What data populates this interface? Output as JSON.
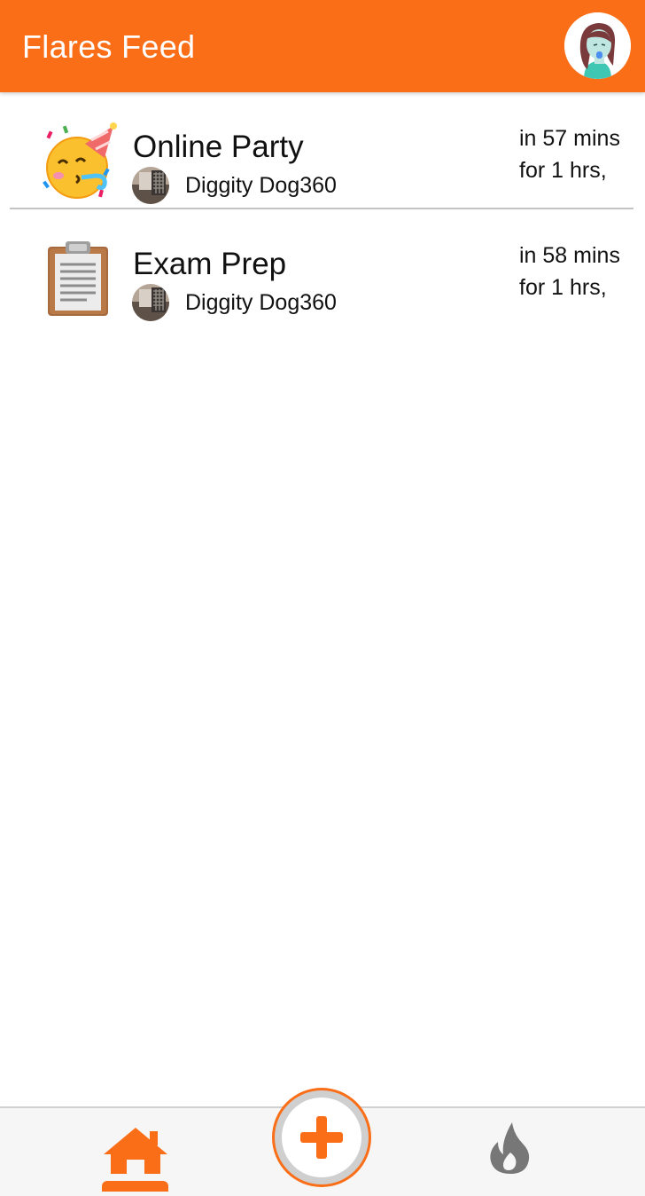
{
  "app_bar": {
    "title": "Flares Feed",
    "profile_icon": "user-avatar-icon"
  },
  "theme": {
    "accent": "#fa6e18",
    "background": "#ffffff",
    "nav_background": "#f6f6f6",
    "inactive_icon": "#777777"
  },
  "feed": {
    "items": [
      {
        "icon": "party-face-emoji-icon",
        "title": "Online Party",
        "host_name": "Diggity Dog360",
        "host_avatar": "host-avatar-icon",
        "starts": "in 57 mins",
        "duration": "for 1 hrs,"
      },
      {
        "icon": "clipboard-emoji-icon",
        "title": "Exam Prep",
        "host_name": "Diggity Dog360",
        "host_avatar": "host-avatar-icon",
        "starts": "in 58 mins",
        "duration": "for 1 hrs,"
      }
    ]
  },
  "bottom_nav": {
    "items": [
      {
        "icon": "home-icon",
        "active": true
      },
      {
        "icon": "add-icon",
        "active": false
      },
      {
        "icon": "flame-icon",
        "active": false
      }
    ]
  }
}
